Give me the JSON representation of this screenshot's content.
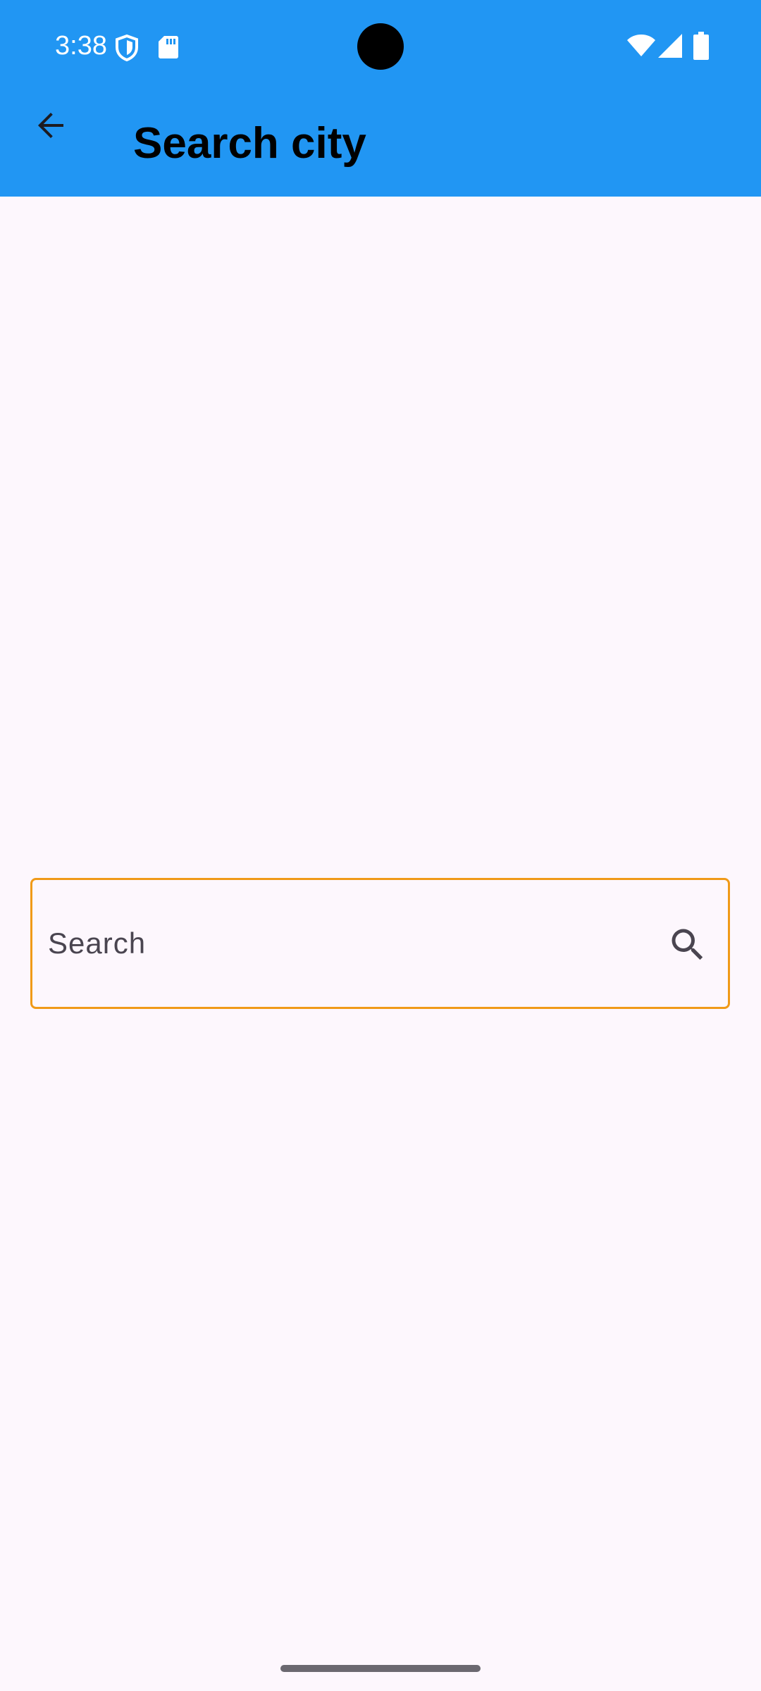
{
  "status_bar": {
    "time": "3:38",
    "icons": [
      "shield-icon",
      "sd-card-icon",
      "wifi-icon",
      "cellular-signal-icon",
      "battery-icon"
    ]
  },
  "toolbar": {
    "back_icon": "arrow-back-icon",
    "title": "Search city"
  },
  "search": {
    "placeholder": "Search",
    "value": "",
    "icon": "search-icon"
  },
  "colors": {
    "app_bar": "#2196F3",
    "background": "#FDF7FD",
    "search_border": "#F09A18",
    "text_secondary": "#4A4550"
  }
}
